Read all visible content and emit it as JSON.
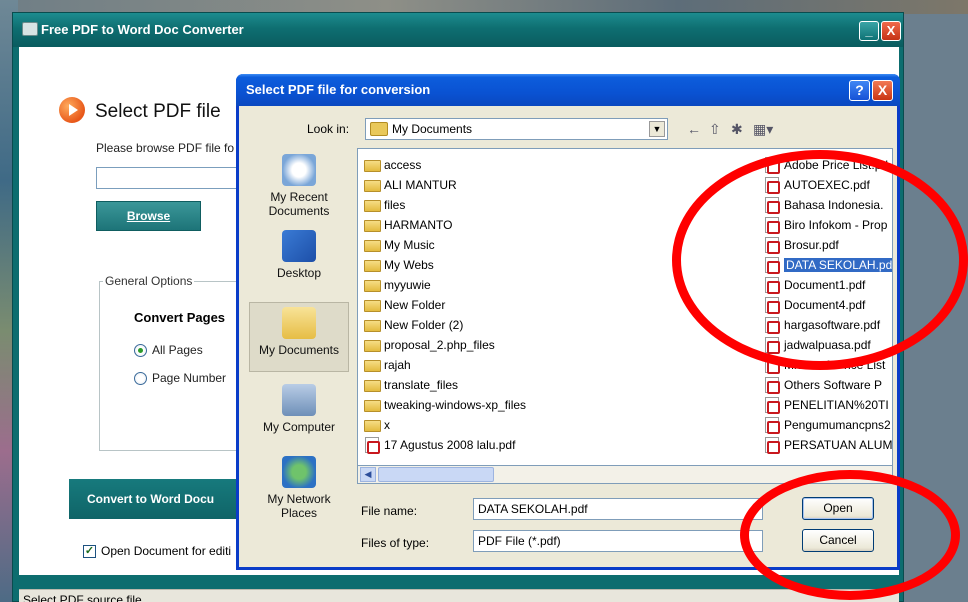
{
  "main_window": {
    "title": "Free PDF to Word Doc Converter",
    "minimize": "_",
    "close": "X",
    "select_heading": "Select PDF file",
    "browse_hint": "Please browse PDF file fo",
    "path_value": "",
    "browse_button": "Browse",
    "general_options": "General Options",
    "convert_pages": "Convert Pages",
    "all_pages": "All Pages",
    "page_number": "Page Number",
    "convert_button": "Convert to Word Docu",
    "open_document": "Open Document for editi",
    "status": "Select PDF source file"
  },
  "dialog": {
    "title": "Select PDF file for conversion",
    "help": "?",
    "close": "X",
    "look_in_label": "Look in:",
    "look_in_value": "My Documents",
    "places": [
      "My Recent Documents",
      "Desktop",
      "My Documents",
      "My Computer",
      "My Network Places"
    ],
    "folders": [
      "access",
      "ALI MANTUR",
      "files",
      "HARMANTO",
      "My Music",
      "My Webs",
      "myyuwie",
      "New Folder",
      "New Folder (2)",
      "proposal_2.php_files",
      "rajah",
      "translate_files",
      "tweaking-windows-xp_files",
      "x",
      "17 Agustus 2008 lalu.pdf"
    ],
    "files_right": [
      "Adobe Price List.pd",
      "AUTOEXEC.pdf",
      "Bahasa Indonesia.",
      "Biro Infokom - Prop",
      "Brosur.pdf",
      "DATA SEKOLAH.pd",
      "Document1.pdf",
      "Document4.pdf",
      "hargasoftware.pdf",
      "jadwalpuasa.pdf",
      "Microsoft Price List",
      "Others Software P",
      "PENELITIAN%20TI",
      "Pengumumancpns2",
      "PERSATUAN ALUM"
    ],
    "file_name_label": "File name:",
    "file_name_value": "DATA SEKOLAH.pdf",
    "files_of_type_label": "Files of type:",
    "files_of_type_value": "PDF File (*.pdf)",
    "open_button": "Open",
    "cancel_button": "Cancel"
  },
  "colors": {
    "teal_title": "#0e6e71",
    "xp_blue": "#0a52d2",
    "annotation_red": "#ff0000",
    "selection_blue": "#316ac5"
  }
}
